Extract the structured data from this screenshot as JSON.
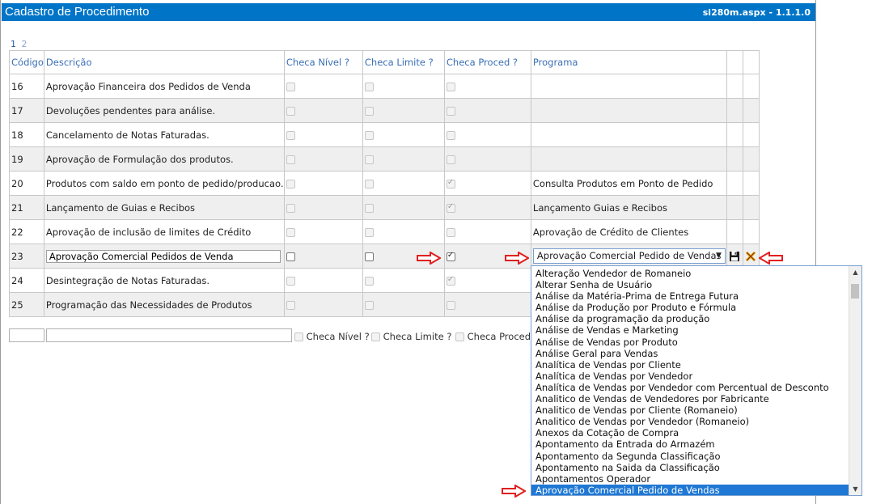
{
  "window": {
    "title": "Cadastro de Procedimento",
    "version": "si280m.aspx - 1.1.1.0"
  },
  "pager": {
    "pages": [
      "1",
      "2"
    ]
  },
  "columns": {
    "code": "Código",
    "desc": "Descrição",
    "nivel": "Checa Nível ?",
    "limite": "Checa Limite ?",
    "proced": "Checa Proced ?",
    "programa": "Programa"
  },
  "rows": [
    {
      "code": "16",
      "desc": "Aprovação Financeira dos Pedidos de Venda",
      "nivel": false,
      "limite": false,
      "proced": false,
      "programa": ""
    },
    {
      "code": "17",
      "desc": "Devoluções pendentes para análise.",
      "nivel": false,
      "limite": false,
      "proced": false,
      "programa": ""
    },
    {
      "code": "18",
      "desc": "Cancelamento de Notas Faturadas.",
      "nivel": false,
      "limite": false,
      "proced": false,
      "programa": ""
    },
    {
      "code": "19",
      "desc": "Aprovação de Formulação dos produtos.",
      "nivel": false,
      "limite": false,
      "proced": false,
      "programa": ""
    },
    {
      "code": "20",
      "desc": "Produtos com saldo em ponto de pedido/producao.",
      "nivel": false,
      "limite": false,
      "proced": true,
      "programa": "Consulta Produtos em Ponto de Pedido"
    },
    {
      "code": "21",
      "desc": "Lançamento de Guias e Recibos",
      "nivel": false,
      "limite": false,
      "proced": true,
      "programa": "Lançamento Guias e Recibos"
    },
    {
      "code": "22",
      "desc": "Aprovação de inclusão de limites de Crédito",
      "nivel": false,
      "limite": false,
      "proced": false,
      "programa": "Aprovação de Crédito de Clientes"
    }
  ],
  "edit_row": {
    "code": "23",
    "desc_value": "Aprovação Comercial Pedidos de Venda",
    "nivel": false,
    "limite": false,
    "proced": true,
    "programa_selected": "Aprovação Comercial Pedido de Vendas"
  },
  "rows_after": [
    {
      "code": "24",
      "desc": "Desintegração de Notas Faturadas.",
      "nivel": false,
      "limite": false,
      "proced": true,
      "programa": ""
    },
    {
      "code": "25",
      "desc": "Programação das Necessidades de Produtos",
      "nivel": false,
      "limite": false,
      "proced": false,
      "programa": ""
    }
  ],
  "new_row": {
    "nivel_label": "Checa Nível ?",
    "limite_label": "Checa Limite ?",
    "proced_label": "Checa Proced ?"
  },
  "dropdown_options": [
    "Alteração Vendedor de Romaneio",
    "Alterar Senha de Usuário",
    "Análise da Matéria-Prima de Entrega Futura",
    "Análise da Produção por Produto e Fórmula",
    "Análise da programação da produção",
    "Análise de Vendas e Marketing",
    "Análise de Vendas por Produto",
    "Análise Geral para Vendas",
    "Analítica de Vendas por Cliente",
    "Analítica de Vendas por Vendedor",
    "Analítica de Vendas por Vendedor com Percentual de Desconto",
    "Analitico de Vendas de Vendedores por Fabricante",
    "Analitico de Vendas por Cliente (Romaneio)",
    "Analitico de Vendas por Vendedor (Romaneio)",
    "Anexos da Cotação de Compra",
    "Apontamento da Entrada do Armazém",
    "Apontamento da Segunda Classificação",
    "Apontamento na Saida da Classificação",
    "Apontamentos Operador",
    "Aprovação Comercial Pedido de Vendas"
  ],
  "colors": {
    "title_bar": "#0074c7",
    "header_text": "#3a6fb5",
    "selected_option": "#1e78d4",
    "arrow": "#e02020"
  },
  "icons": {
    "save": "floppy-disk-icon",
    "cancel": "cancel-x-icon"
  }
}
